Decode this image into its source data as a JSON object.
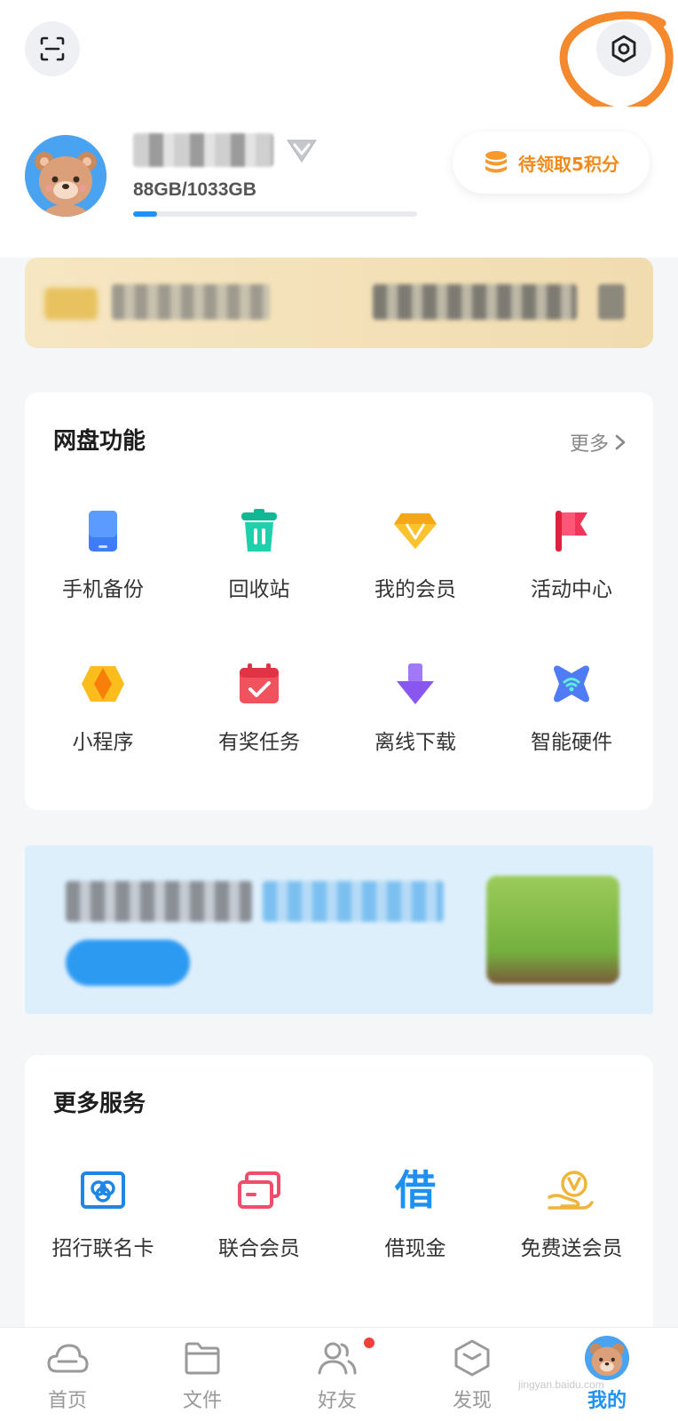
{
  "profile": {
    "storage_text": "88GB/1033GB",
    "storage_used_fraction": 0.085,
    "points_label": "待领取5积分"
  },
  "netdisk_card": {
    "title": "网盘功能",
    "more_label": "更多",
    "items": [
      {
        "label": "手机备份",
        "icon": "phone-backup-icon",
        "color": "#3d7df5"
      },
      {
        "label": "回收站",
        "icon": "trash-icon",
        "color": "#12c2a0"
      },
      {
        "label": "我的会员",
        "icon": "diamond-icon",
        "color": "#f6a619"
      },
      {
        "label": "活动中心",
        "icon": "flag-icon",
        "color": "#f0345a"
      },
      {
        "label": "小程序",
        "icon": "mini-program-icon",
        "color": "#fbbd1c"
      },
      {
        "label": "有奖任务",
        "icon": "calendar-check-icon",
        "color": "#f0525e"
      },
      {
        "label": "离线下载",
        "icon": "download-arrow-icon",
        "color": "#8a56f0"
      },
      {
        "label": "智能硬件",
        "icon": "smart-hardware-icon",
        "color": "#4f7cf4"
      }
    ]
  },
  "services_card": {
    "title": "更多服务",
    "items": [
      {
        "label": "招行联名卡",
        "icon": "bank-card-icon",
        "color": "#1f86e6"
      },
      {
        "label": "联合会员",
        "icon": "cards-icon",
        "color": "#ef4d6b"
      },
      {
        "label": "借现金",
        "icon": "borrow-char-icon",
        "glyph": "借",
        "color": "#1e90f0"
      },
      {
        "label": "免费送会员",
        "icon": "coin-hand-icon",
        "color": "#efb43a"
      }
    ]
  },
  "bottom_nav": [
    {
      "label": "首页",
      "icon": "cloud-icon"
    },
    {
      "label": "文件",
      "icon": "folder-icon"
    },
    {
      "label": "好友",
      "icon": "friends-icon"
    },
    {
      "label": "发现",
      "icon": "discover-icon"
    },
    {
      "label": "我的",
      "icon": "avatar-icon",
      "active": true
    }
  ],
  "watermark": "jingyan.baidu.com",
  "colors": {
    "accent": "#1e93f5",
    "points": "#f08a1a",
    "annotation": "#f4892e"
  }
}
